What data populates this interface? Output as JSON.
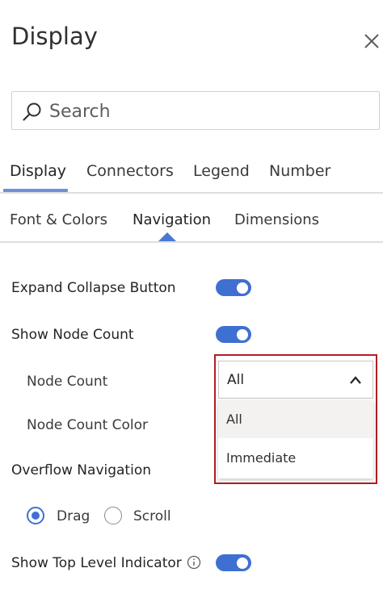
{
  "pane": {
    "title": "Display"
  },
  "search": {
    "placeholder": "Search"
  },
  "main_tabs": [
    {
      "label": "Display",
      "active": true
    },
    {
      "label": "Connectors",
      "active": false
    },
    {
      "label": "Legend",
      "active": false
    },
    {
      "label": "Number",
      "active": false
    }
  ],
  "sub_tabs": [
    {
      "label": "Font & Colors",
      "active": false
    },
    {
      "label": "Navigation",
      "active": true
    },
    {
      "label": "Dimensions",
      "active": false
    }
  ],
  "settings": {
    "expand_collapse": {
      "label": "Expand Collapse Button",
      "on": true
    },
    "show_node_count": {
      "label": "Show Node Count",
      "on": true
    },
    "node_count": {
      "label": "Node Count",
      "selected": "All",
      "options": [
        "All",
        "Immediate"
      ]
    },
    "node_count_color": {
      "label": "Node Count Color"
    },
    "overflow_navigation": {
      "label": "Overflow Navigation",
      "options": [
        {
          "label": "Drag",
          "selected": true
        },
        {
          "label": "Scroll",
          "selected": false
        }
      ]
    },
    "show_top_level_indicator": {
      "label": "Show Top Level Indicator",
      "on": true
    }
  },
  "colors": {
    "accent": "#3f6fd1",
    "tab_indicator": "#6f8fd8",
    "highlight_border": "#b01e23"
  },
  "icons": {
    "close": "close-icon",
    "search": "search-icon",
    "chevron": "chevron-up-icon",
    "info": "info-icon"
  }
}
